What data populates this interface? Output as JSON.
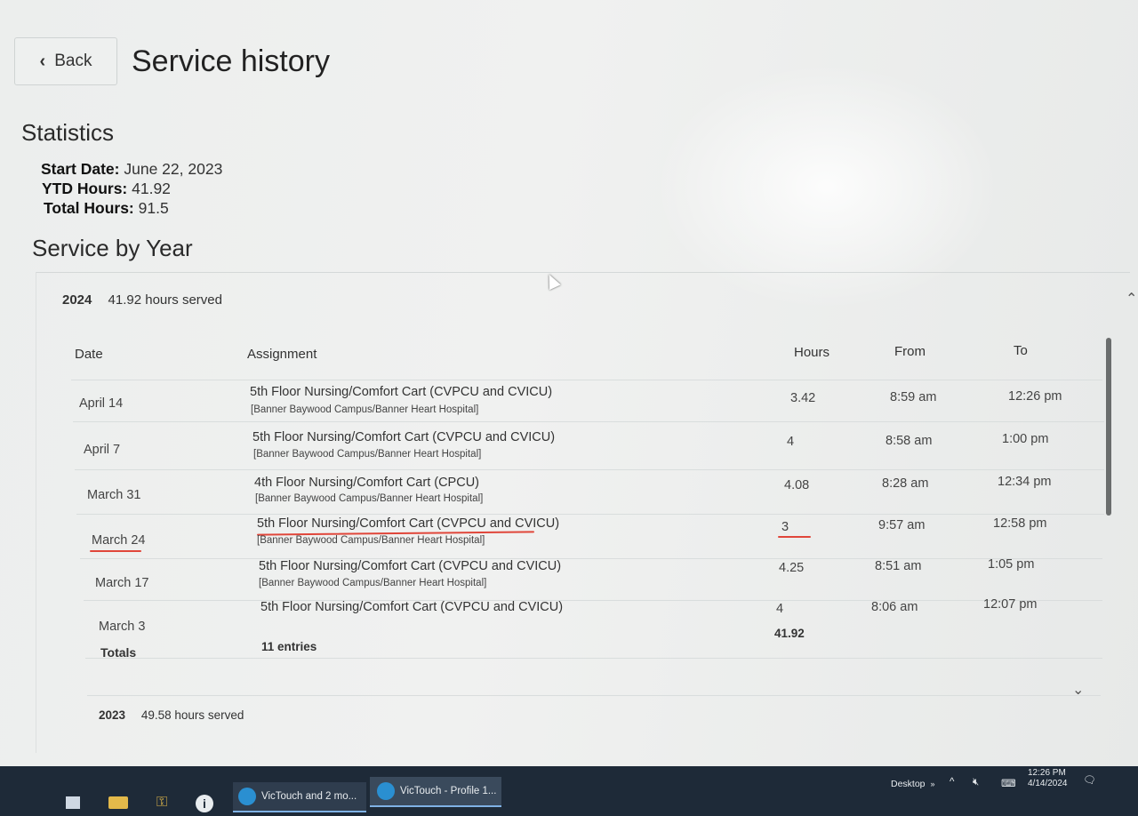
{
  "header": {
    "back_label": "Back",
    "title": "Service history"
  },
  "statistics": {
    "heading": "Statistics",
    "start_date_label": "Start Date:",
    "start_date_value": "June 22, 2023",
    "ytd_label": "YTD Hours:",
    "ytd_value": "41.92",
    "total_label": "Total Hours:",
    "total_value": "91.5"
  },
  "service_by_year": {
    "heading": "Service by Year",
    "years": [
      {
        "year": "2024",
        "summary": "41.92 hours served",
        "expanded": true
      },
      {
        "year": "2023",
        "summary": "49.58 hours served",
        "expanded": false
      }
    ],
    "columns": {
      "date": "Date",
      "assignment": "Assignment",
      "hours": "Hours",
      "from": "From",
      "to": "To"
    },
    "rows": [
      {
        "date": "April 14",
        "assignment": "5th Floor Nursing/Comfort Cart (CVPCU and CVICU)",
        "location": "[Banner Baywood Campus/Banner Heart Hospital]",
        "hours": "3.42",
        "from": "8:59 am",
        "to": "12:26 pm"
      },
      {
        "date": "April 7",
        "assignment": "5th Floor Nursing/Comfort Cart (CVPCU and CVICU)",
        "location": "[Banner Baywood Campus/Banner Heart Hospital]",
        "hours": "4",
        "from": "8:58 am",
        "to": "1:00 pm"
      },
      {
        "date": "March 31",
        "assignment": "4th Floor Nursing/Comfort Cart (CPCU)",
        "location": "[Banner Baywood Campus/Banner Heart Hospital]",
        "hours": "4.08",
        "from": "8:28 am",
        "to": "12:34 pm"
      },
      {
        "date": "March 24",
        "assignment": "5th Floor Nursing/Comfort Cart (CVPCU and CVICU)",
        "location": "[Banner Baywood Campus/Banner Heart Hospital]",
        "hours": "3",
        "from": "9:57 am",
        "to": "12:58 pm"
      },
      {
        "date": "March 17",
        "assignment": "5th Floor Nursing/Comfort Cart (CVPCU and CVICU)",
        "location": "[Banner Baywood Campus/Banner Heart Hospital]",
        "hours": "4.25",
        "from": "8:51 am",
        "to": "1:05 pm"
      },
      {
        "date": "March 3",
        "assignment": "5th Floor Nursing/Comfort Cart (CVPCU and CVICU)",
        "location": "",
        "hours": "4",
        "from": "8:06 am",
        "to": "12:07 pm"
      }
    ],
    "totals": {
      "label": "Totals",
      "entries": "11 entries",
      "hours": "41.92"
    }
  },
  "taskbar": {
    "apps": [
      "VicTouch and 2 mo...",
      "VicTouch - Profile 1..."
    ],
    "desktop_label": "Desktop",
    "time": "12:26 PM",
    "date": "4/14/2024"
  }
}
